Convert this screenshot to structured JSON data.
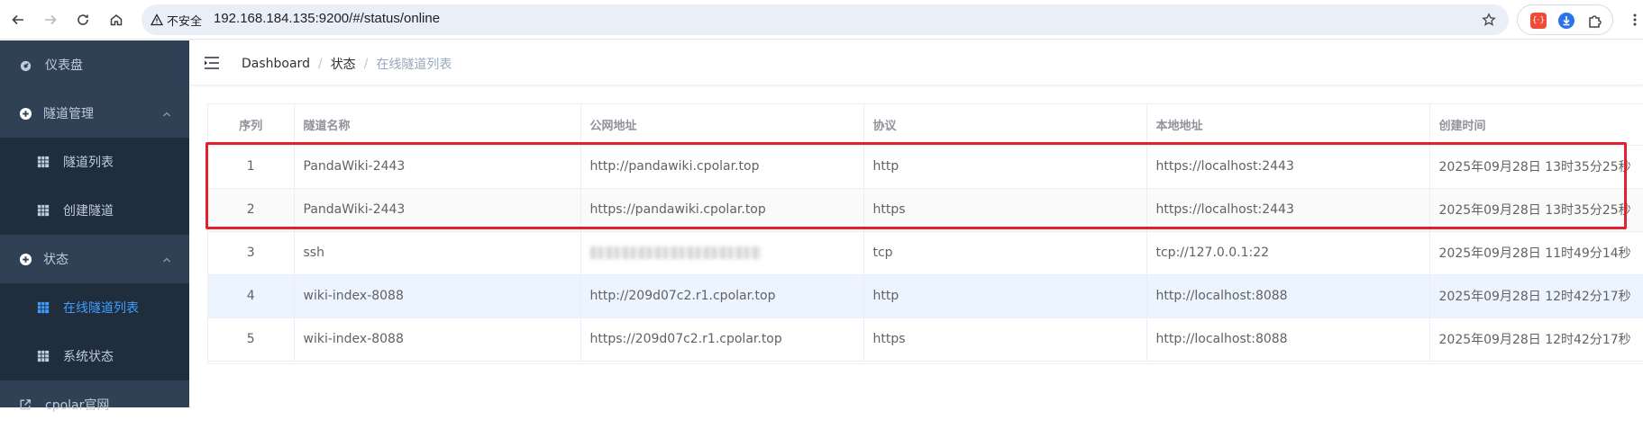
{
  "browser": {
    "security_label": "不安全",
    "url": "192.168.184.135:9200/#/status/online",
    "extension_label": "{·}"
  },
  "sidebar": {
    "items": [
      {
        "label": "仪表盘",
        "icon": "dashboard-icon"
      },
      {
        "label": "隧道管理",
        "icon": "plus-circle-icon",
        "expanded": true
      },
      {
        "label": "隧道列表",
        "icon": "table-icon"
      },
      {
        "label": "创建隧道",
        "icon": "table-icon"
      },
      {
        "label": "状态",
        "icon": "plus-circle-icon",
        "expanded": true
      },
      {
        "label": "在线隧道列表",
        "icon": "table-icon",
        "active": true
      },
      {
        "label": "系统状态",
        "icon": "table-icon"
      },
      {
        "label": "cpolar官网",
        "icon": "external-link-icon"
      }
    ]
  },
  "breadcrumb": {
    "items": [
      "Dashboard",
      "状态",
      "在线隧道列表"
    ]
  },
  "table": {
    "columns": [
      "序列",
      "隧道名称",
      "公网地址",
      "协议",
      "本地地址",
      "创建时间"
    ],
    "rows": [
      {
        "index": "1",
        "name": "PandaWiki-2443",
        "public_url": "http://pandawiki.cpolar.top",
        "protocol": "http",
        "local": "https://localhost:2443",
        "created": "2025年09月28日 13时35分25秒"
      },
      {
        "index": "2",
        "name": "PandaWiki-2443",
        "public_url": "https://pandawiki.cpolar.top",
        "protocol": "https",
        "local": "https://localhost:2443",
        "created": "2025年09月28日 13时35分25秒"
      },
      {
        "index": "3",
        "name": "ssh",
        "public_url": "",
        "protocol": "tcp",
        "local": "tcp://127.0.0.1:22",
        "created": "2025年09月28日 11时49分14秒"
      },
      {
        "index": "4",
        "name": "wiki-index-8088",
        "public_url": "http://209d07c2.r1.cpolar.top",
        "protocol": "http",
        "local": "http://localhost:8088",
        "created": "2025年09月28日 12时42分17秒"
      },
      {
        "index": "5",
        "name": "wiki-index-8088",
        "public_url": "https://209d07c2.r1.cpolar.top",
        "protocol": "https",
        "local": "http://localhost:8088",
        "created": "2025年09月28日 12时42分17秒"
      }
    ]
  },
  "colors": {
    "sidebar_bg": "#304156",
    "sidebar_sub_bg": "#1f2d3d",
    "active": "#409eff",
    "annotation_box": "#e5202e"
  }
}
